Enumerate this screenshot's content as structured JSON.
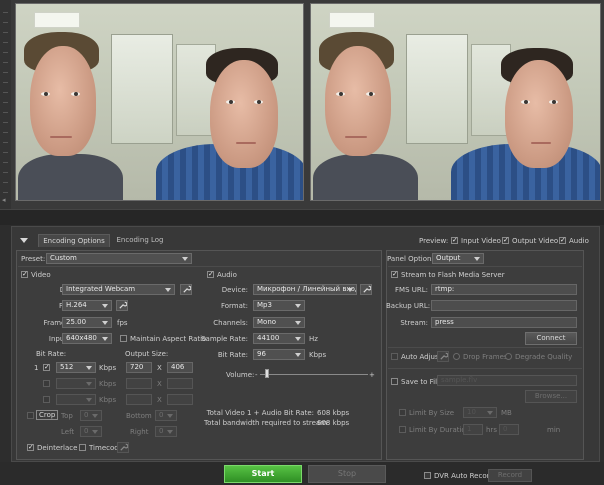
{
  "tabs": {
    "encoding_options": "Encoding Options",
    "encoding_log": "Encoding Log"
  },
  "preview": {
    "label": "Preview:",
    "input_video": "Input Video",
    "output_video": "Output Video",
    "audio": "Audio"
  },
  "preset": {
    "label": "Preset:",
    "value": "Custom"
  },
  "panel_options": {
    "label": "Panel Options:",
    "value": "Output"
  },
  "video": {
    "title": "Video",
    "device_label": "Device:",
    "device_value": "Integrated Webcam",
    "format_label": "Format:",
    "format_value": "H.264",
    "frame_rate_label": "Frame Rate:",
    "frame_rate_value": "25.00",
    "fps": "fps",
    "input_size_label": "Input Size:",
    "input_size_value": "640x480",
    "maintain_aspect": "Maintain Aspect Ratio",
    "bit_rate_label": "Bit Rate:",
    "output_size_label": "Output Size:",
    "row1_num": "1",
    "bitrate_value": "512",
    "kbps": "Kbps",
    "out_w": "720",
    "out_h": "406",
    "x": "X",
    "crop_label": "Crop",
    "top": "Top",
    "bottom": "Bottom",
    "left": "Left",
    "right": "Right",
    "top_value": "0",
    "bottom_value": "0",
    "left_value": "0",
    "right_value": "0",
    "deinterlace": "Deinterlace",
    "timecode": "Timecode"
  },
  "audio": {
    "title": "Audio",
    "device_label": "Device:",
    "device_value": "Микрофон / Линейный вход (",
    "format_label": "Format:",
    "format_value": "Mp3",
    "channels_label": "Channels:",
    "channels_value": "Mono",
    "sample_rate_label": "Sample Rate:",
    "sample_rate_value": "44100",
    "hz": "Hz",
    "bit_rate_label": "Bit Rate:",
    "bit_rate_value": "96",
    "kbps": "Kbps",
    "volume_label": "Volume:",
    "minus": "-",
    "plus": "+",
    "volume_level": 0.05
  },
  "totals": {
    "line1_label": "Total Video 1 + Audio Bit Rate:",
    "line1_value": "608 kbps",
    "line2_label": "Total bandwidth required to stream:",
    "line2_value": "608 kbps"
  },
  "output": {
    "stream_to_fms": "Stream to Flash Media Server",
    "fms_url_label": "FMS URL:",
    "fms_url_value": "rtmp:",
    "backup_url_label": "Backup URL:",
    "backup_url_value": "",
    "stream_label": "Stream:",
    "stream_value": "press",
    "connect": "Connect",
    "auto_adjust": "Auto Adjust",
    "drop_frames": "Drop Frames",
    "degrade_quality": "Degrade Quality",
    "save_to_file": "Save to File",
    "save_file_value": "sample.flv",
    "browse": "Browse...",
    "limit_by_size": "Limit By Size",
    "size_value": "10",
    "mb": "MB",
    "limit_by_duration": "Limit By Duration",
    "dur_h": "1",
    "hrs": "hrs",
    "dur_m": "0",
    "min": "min"
  },
  "bottom": {
    "start": "Start",
    "stop": "Stop",
    "dvr_auto_record": "DVR Auto Record",
    "record": "Record"
  },
  "colors": {
    "start_green": "#3da52f",
    "panel": "#383838",
    "background": "#2d2d2d"
  }
}
